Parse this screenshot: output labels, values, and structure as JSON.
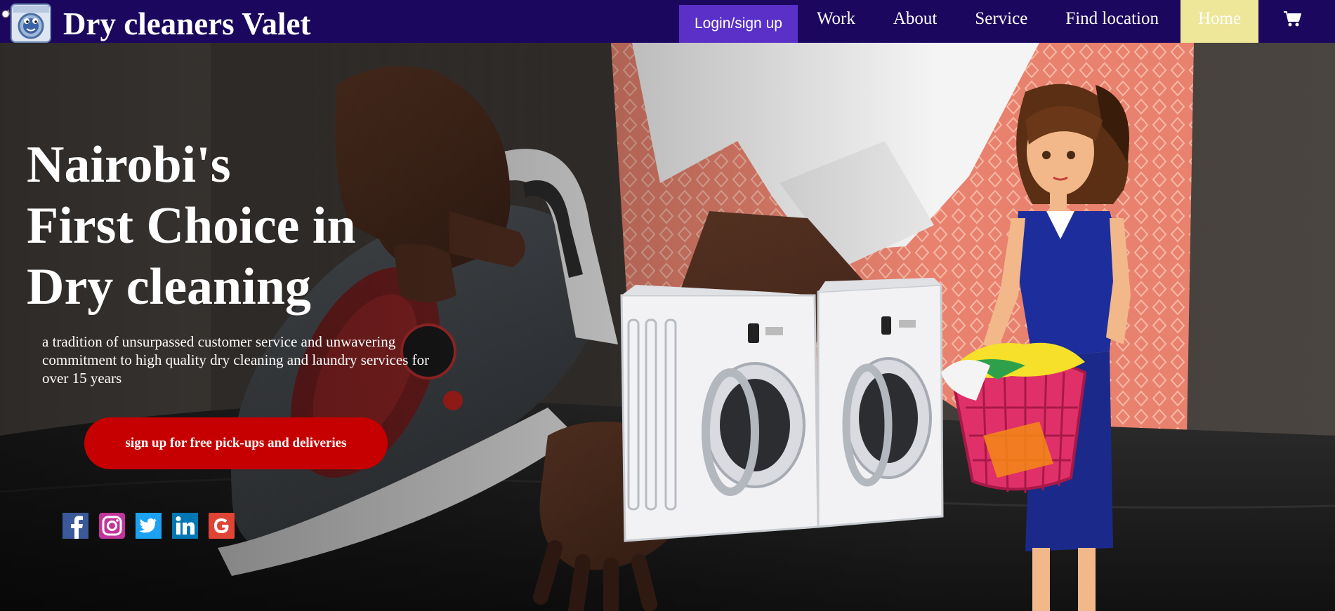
{
  "brand": {
    "name": "Dry cleaners Valet"
  },
  "nav": {
    "login": "Login/sign up",
    "items": [
      {
        "label": "Work"
      },
      {
        "label": "About"
      },
      {
        "label": "Service"
      },
      {
        "label": "Find location"
      },
      {
        "label": "Home"
      }
    ]
  },
  "hero": {
    "headline": [
      "Nairobi's",
      "First Choice in",
      "Dry cleaning"
    ],
    "tagline": "a tradition of unsurpassed customer service and unwavering commitment to high quality dry cleaning and laundry services for over 15 years",
    "cta": "sign up for free pick-ups and deliveries"
  },
  "social": [
    {
      "icon": "facebook-icon"
    },
    {
      "icon": "instagram-icon"
    },
    {
      "icon": "twitter-icon"
    },
    {
      "icon": "linkedin-icon"
    },
    {
      "icon": "google-icon"
    }
  ],
  "colors": {
    "navbar": "#1b075e",
    "login_button": "#5a30c8",
    "home_active": "#eee699",
    "cta": "#c60000"
  }
}
